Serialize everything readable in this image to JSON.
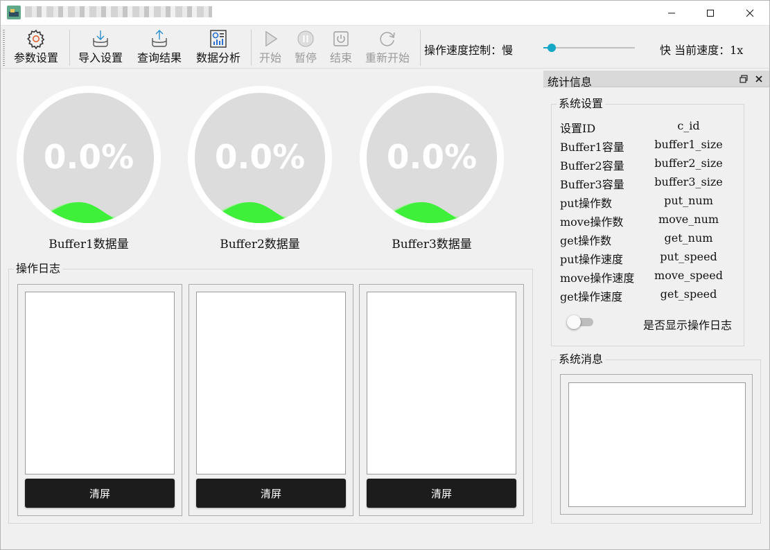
{
  "colors": {
    "accent": "#16a7c6",
    "wave": "#3ef03a",
    "gauge_fill": "#dcdcdc",
    "button_dark": "#1c1c1c"
  },
  "window": {
    "title_icon": "app-icon",
    "controls": [
      "minimize-icon",
      "maximize-icon",
      "close-icon"
    ]
  },
  "toolbar": {
    "buttons": [
      {
        "label": "参数设置",
        "icon": "gear-icon",
        "enabled": true
      },
      {
        "label": "导入设置",
        "icon": "import-icon",
        "enabled": true
      },
      {
        "label": "查询结果",
        "icon": "export-icon",
        "enabled": true
      },
      {
        "label": "数据分析",
        "icon": "analytics-icon",
        "enabled": true
      },
      {
        "label": "开始",
        "icon": "play-icon",
        "enabled": false
      },
      {
        "label": "暂停",
        "icon": "pause-icon",
        "enabled": false
      },
      {
        "label": "结束",
        "icon": "stop-icon",
        "enabled": false
      },
      {
        "label": "重新开始",
        "icon": "restart-icon",
        "enabled": false
      }
    ],
    "speed": {
      "label": "操作速度控制：慢",
      "fast_label": "快 当前速度：1x",
      "value_fraction": 0.05
    }
  },
  "gauges": [
    {
      "percent_text": "0.0%",
      "label": "Buffer1数据量"
    },
    {
      "percent_text": "0.0%",
      "label": "Buffer2数据量"
    },
    {
      "percent_text": "0.0%",
      "label": "Buffer3数据量"
    }
  ],
  "operation_log": {
    "title": "操作日志",
    "panels": [
      {
        "clear_label": "清屏"
      },
      {
        "clear_label": "清屏"
      },
      {
        "clear_label": "清屏"
      }
    ]
  },
  "stats_dock": {
    "title": "统计信息",
    "settings_group_title": "系统设置",
    "rows": [
      {
        "key": "设置ID",
        "value": "c_id"
      },
      {
        "key": "Buffer1容量",
        "value": "buffer1_size"
      },
      {
        "key": "Buffer2容量",
        "value": "buffer2_size"
      },
      {
        "key": "Buffer3容量",
        "value": "buffer3_size"
      },
      {
        "key": "put操作数",
        "value": "put_num"
      },
      {
        "key": "move操作数",
        "value": "move_num"
      },
      {
        "key": "get操作数",
        "value": "get_num"
      },
      {
        "key": "put操作速度",
        "value": "put_speed"
      },
      {
        "key": "move操作速度",
        "value": "move_speed"
      },
      {
        "key": "get操作速度",
        "value": "get_speed"
      }
    ],
    "toggle": {
      "label": "是否显示操作日志",
      "on": false
    },
    "messages_group_title": "系统消息"
  }
}
